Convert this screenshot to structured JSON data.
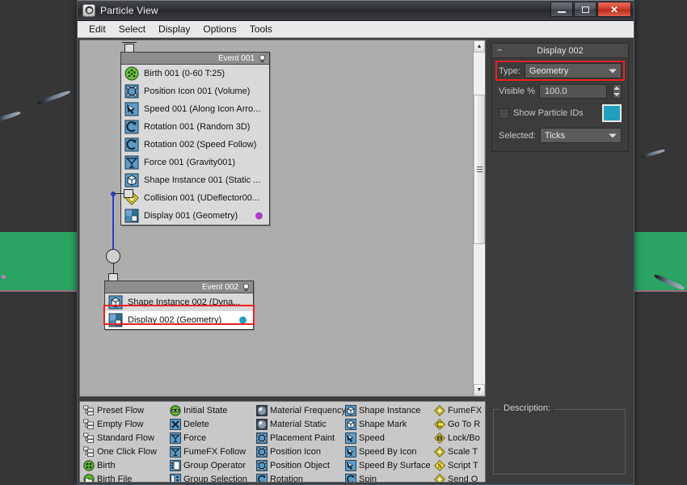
{
  "window": {
    "title": "Particle View",
    "app_icon": "particle-flow-icon",
    "buttons": {
      "minimize": "minimize-icon",
      "maximize": "maximize-icon",
      "close": "✕"
    }
  },
  "menubar": {
    "items": [
      {
        "label": "Edit"
      },
      {
        "label": "Select"
      },
      {
        "label": "Display"
      },
      {
        "label": "Options"
      },
      {
        "label": "Tools"
      }
    ]
  },
  "canvas": {
    "events": [
      {
        "title": "Event 001",
        "operators": [
          {
            "label": "Birth 001 (0-60 T:25)",
            "icon": "birth-icon",
            "selected": false,
            "dot": null
          },
          {
            "label": "Position Icon 001 (Volume)",
            "icon": "position-icon",
            "selected": false,
            "dot": null
          },
          {
            "label": "Speed 001 (Along Icon Arro...",
            "icon": "speed-icon",
            "selected": false,
            "dot": null
          },
          {
            "label": "Rotation 001 (Random 3D)",
            "icon": "rotation-icon",
            "selected": false,
            "dot": null
          },
          {
            "label": "Rotation 002 (Speed Follow)",
            "icon": "rotation-icon",
            "selected": false,
            "dot": null
          },
          {
            "label": "Force 001 (Gravity001)",
            "icon": "force-icon",
            "selected": false,
            "dot": null
          },
          {
            "label": "Shape Instance 001 (Static ...",
            "icon": "shape-instance-icon",
            "selected": false,
            "dot": null
          },
          {
            "label": "Collision 001 (UDeflector00...",
            "icon": "collision-icon",
            "selected": false,
            "dot": null
          },
          {
            "label": "Display 001 (Geometry)",
            "icon": "display-icon",
            "selected": false,
            "dot": "#b23ccb"
          }
        ]
      },
      {
        "title": "Event 002",
        "operators": [
          {
            "label": "Shape Instance 002 (Dyna...",
            "icon": "shape-instance-icon",
            "selected": false,
            "dot": null
          },
          {
            "label": "Display 002 (Geometry)",
            "icon": "display-icon",
            "selected": true,
            "dot": "#1fa0bf"
          }
        ]
      }
    ]
  },
  "params": {
    "rollout_title": "Display 002",
    "collapse_glyph": "−",
    "type": {
      "label": "Type:",
      "value": "Geometry"
    },
    "visible": {
      "label": "Visible %",
      "value": "100.0"
    },
    "show_particle_ids": {
      "label": "Show Particle IDs",
      "checked": false
    },
    "color_swatch": "#1fa0bf",
    "selected": {
      "label": "Selected:",
      "value": "Ticks"
    }
  },
  "depot": {
    "columns": [
      {
        "items": [
          {
            "label": "Preset Flow",
            "icon": "flow-icon"
          },
          {
            "label": "Empty Flow",
            "icon": "flow-icon"
          },
          {
            "label": "Standard Flow",
            "icon": "flow-icon"
          },
          {
            "label": "One Click Flow",
            "icon": "flow-icon"
          },
          {
            "label": "Birth",
            "icon": "birth-icon"
          },
          {
            "label": "Birth File",
            "icon": "birth-file-icon"
          }
        ]
      },
      {
        "items": [
          {
            "label": "Initial State",
            "icon": "initial-state-icon"
          },
          {
            "label": "Delete",
            "icon": "delete-icon"
          },
          {
            "label": "Force",
            "icon": "force-icon"
          },
          {
            "label": "FumeFX Follow",
            "icon": "force-icon"
          },
          {
            "label": "Group Operator",
            "icon": "group-operator-icon"
          },
          {
            "label": "Group Selection",
            "icon": "group-selection-icon"
          }
        ]
      },
      {
        "items": [
          {
            "label": "Material Frequency",
            "icon": "material-icon"
          },
          {
            "label": "Material Static",
            "icon": "material-icon"
          },
          {
            "label": "Placement Paint",
            "icon": "position-icon"
          },
          {
            "label": "Position Icon",
            "icon": "position-icon"
          },
          {
            "label": "Position Object",
            "icon": "position-icon"
          },
          {
            "label": "Rotation",
            "icon": "rotation-icon"
          }
        ]
      },
      {
        "items": [
          {
            "label": "Shape Instance",
            "icon": "shape-instance-icon"
          },
          {
            "label": "Shape Mark",
            "icon": "shape-instance-icon"
          },
          {
            "label": "Speed",
            "icon": "speed-icon"
          },
          {
            "label": "Speed By Icon",
            "icon": "speed-icon"
          },
          {
            "label": "Speed By Surface",
            "icon": "speed-icon"
          },
          {
            "label": "Spin",
            "icon": "rotation-icon"
          }
        ]
      },
      {
        "items": [
          {
            "label": "FumeFX",
            "icon": "test-icon"
          },
          {
            "label": "Go To R",
            "icon": "goto-rotation-icon"
          },
          {
            "label": "Lock/Bo",
            "icon": "lock-bond-icon"
          },
          {
            "label": "Scale T",
            "icon": "test-icon"
          },
          {
            "label": "Script T",
            "icon": "script-test-icon"
          },
          {
            "label": "Send O",
            "icon": "test-icon"
          }
        ]
      }
    ]
  },
  "description": {
    "label": "Description:",
    "text": ""
  }
}
